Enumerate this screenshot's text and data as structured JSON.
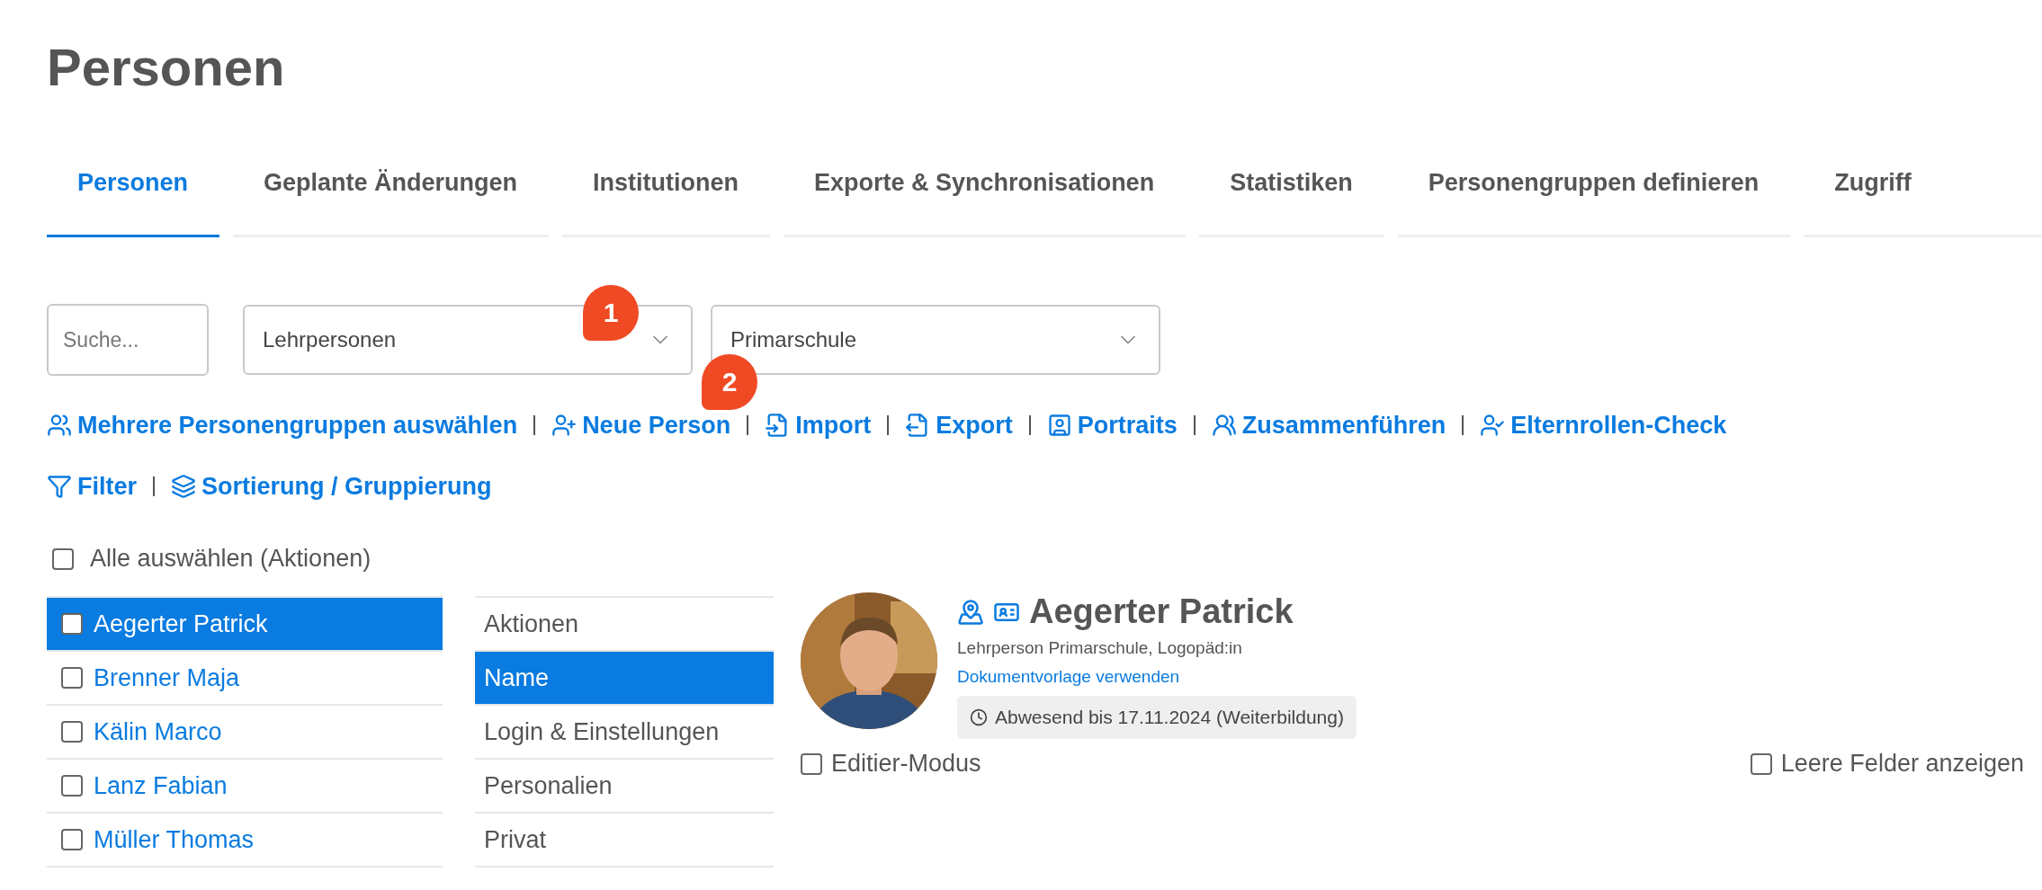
{
  "page_title": "Personen",
  "tabs": [
    {
      "label": "Personen",
      "selected": true
    },
    {
      "label": "Geplante Änderungen",
      "selected": false
    },
    {
      "label": "Institutionen",
      "selected": false
    },
    {
      "label": "Exporte & Synchronisationen",
      "selected": false
    },
    {
      "label": "Statistiken",
      "selected": false
    },
    {
      "label": "Personengruppen definieren",
      "selected": false
    },
    {
      "label": "Zugriff",
      "selected": false
    }
  ],
  "filters": {
    "search": {
      "placeholder": "Suche..."
    },
    "selects": [
      {
        "value": "Lehrpersonen",
        "callout": "1"
      },
      {
        "value": "Primarschule"
      }
    ]
  },
  "toolbar_rows": [
    [
      {
        "label": "Mehrere Personengruppen auswählen"
      },
      {
        "label": "Neue Person",
        "callout": "2"
      },
      {
        "label": "Import"
      },
      {
        "label": "Export"
      },
      {
        "label": "Portraits"
      },
      {
        "label": "Zusammenführen"
      },
      {
        "label": "Elternrollen-Check"
      }
    ],
    [
      {
        "label": "Filter"
      },
      {
        "label": "Sortierung / Gruppierung"
      }
    ]
  ],
  "select_all": {
    "label": "Alle auswählen (Aktionen)",
    "checked": false
  },
  "persons": [
    {
      "name": "Aegerter Patrick",
      "checked": false,
      "selected": true
    },
    {
      "name": "Brenner Maja",
      "checked": false,
      "selected": false
    },
    {
      "name": "Kälin Marco",
      "checked": false,
      "selected": false
    },
    {
      "name": "Lanz Fabian",
      "checked": false,
      "selected": false
    },
    {
      "name": "Müller Thomas",
      "checked": false,
      "selected": false
    }
  ],
  "sections": [
    {
      "label": "Aktionen",
      "selected": false
    },
    {
      "label": "Name",
      "selected": true
    },
    {
      "label": "Login & Einstellungen",
      "selected": false
    },
    {
      "label": "Personalien",
      "selected": false
    },
    {
      "label": "Privat",
      "selected": false
    }
  ],
  "detail": {
    "name": "Aegerter Patrick",
    "roles": "Lehrperson Primarschule, Logopäd:in",
    "link": "Dokumentvorlage verwenden",
    "absence": "Abwesend bis 17.11.2024 (Weiterbildung)",
    "edit_mode": {
      "label": "Editier-Modus",
      "checked": false
    },
    "show_empty": {
      "label": "Leere Felder anzeigen",
      "checked": false
    }
  }
}
